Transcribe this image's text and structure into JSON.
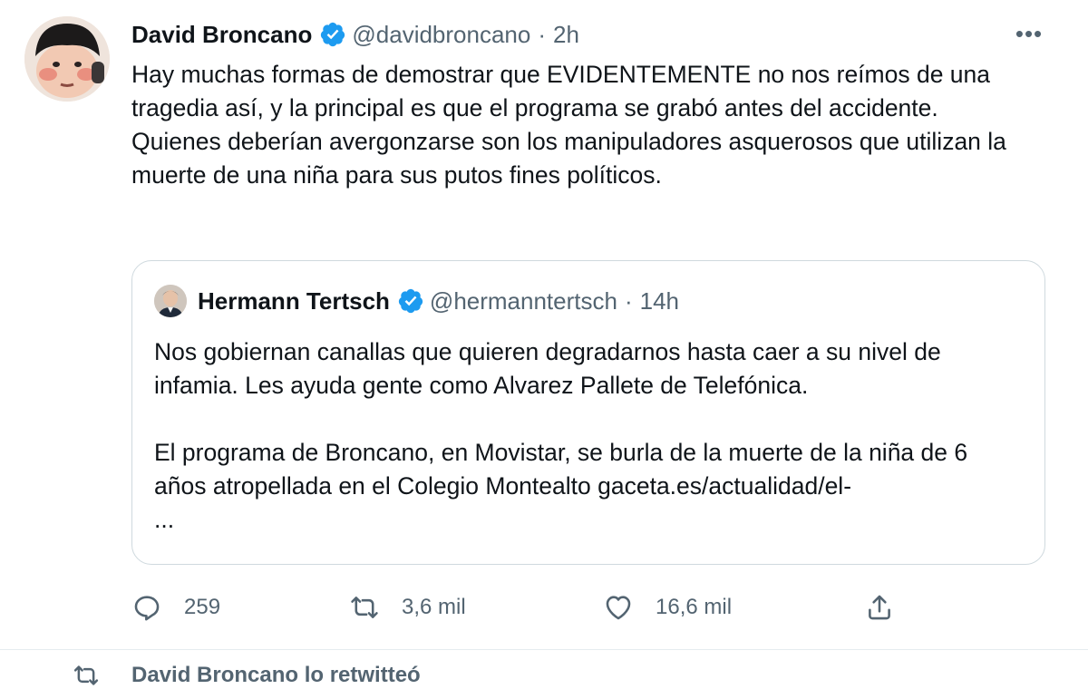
{
  "tweet": {
    "author_name": "David Broncano",
    "handle": "@davidbroncano",
    "separator": "·",
    "time": "2h",
    "more_label": "•••",
    "lines": [
      "Hay muchas formas de demostrar que EVIDENTEMENTE no nos reímos de una tragedia así, y la principal es que el programa se grabó antes del accidente.",
      "Quienes deberían avergonzarse son los manipuladores asquerosos que utilizan la muerte de una niña para sus putos fines políticos."
    ]
  },
  "quoted": {
    "author_name": "Hermann Tertsch",
    "handle": "@hermanntertsch",
    "separator": "·",
    "time": "14h",
    "paragraph1": "Nos gobiernan canallas que quieren degradarnos hasta caer a su nivel de infamia. Les ayuda gente como Alvarez Pallete de Telefónica.",
    "paragraph2": "El programa de Broncano, en Movistar, se burla de la muerte de la niña de 6 años atropellada en el Colegio Montealto gaceta.es/actualidad/el-",
    "ellipsis": "..."
  },
  "actions": {
    "replies": "259",
    "retweets": "3,6 mil",
    "likes": "16,6 mil"
  },
  "next": {
    "retweet_note": "David Broncano lo retwitteó"
  },
  "colors": {
    "verified": "#1d9bf0",
    "muted": "#536471",
    "border": "#cfd9de"
  },
  "icons": [
    "verified-badge-icon",
    "more-icon",
    "reply-icon",
    "retweet-icon",
    "like-icon",
    "share-icon"
  ]
}
